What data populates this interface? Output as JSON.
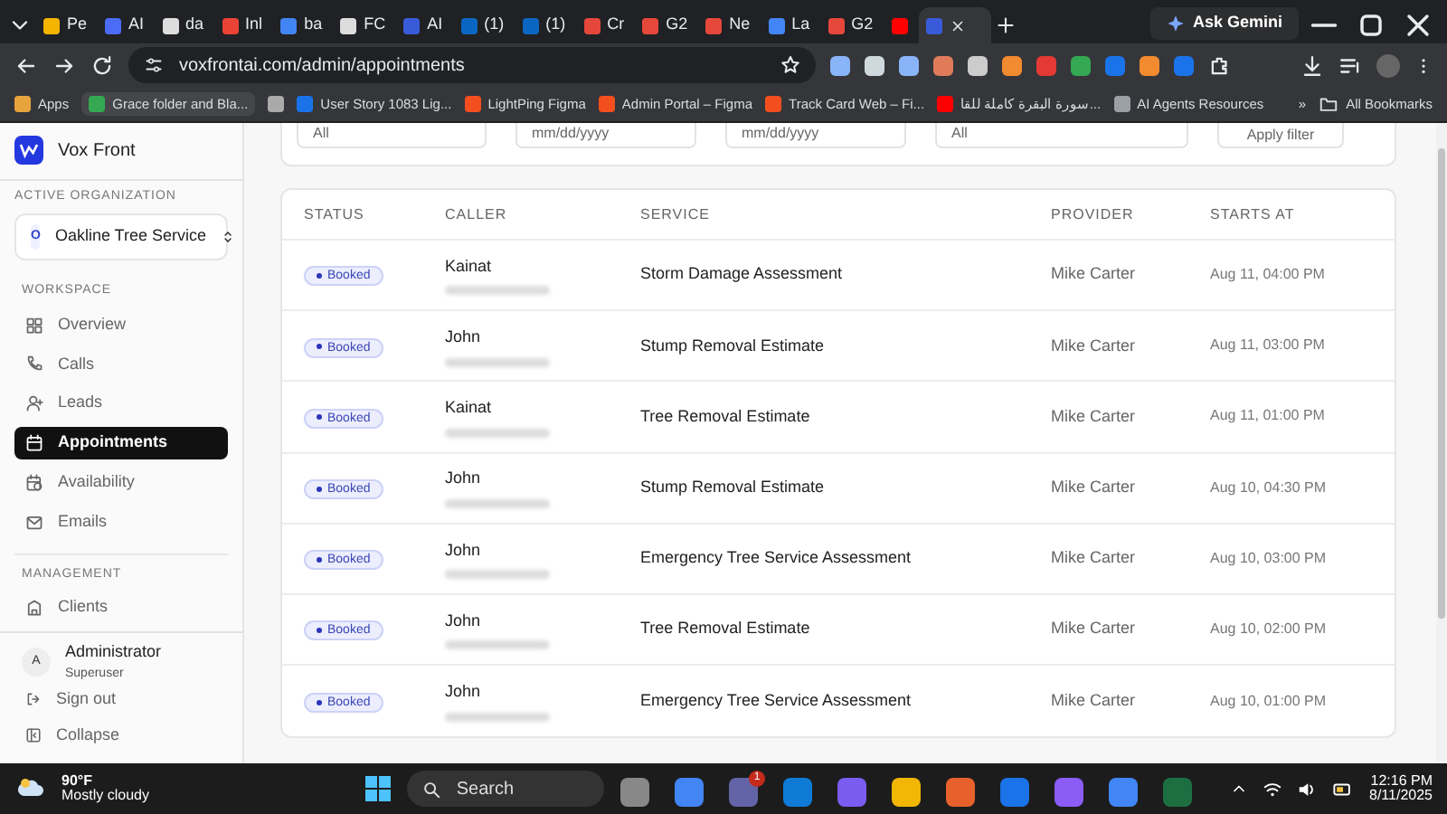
{
  "browser": {
    "tabs": [
      {
        "label": "Pe",
        "color": "#f4b400",
        "selected": false
      },
      {
        "label": "AI",
        "color": "#4a6cf7",
        "selected": false
      },
      {
        "label": "da",
        "color": "#dddddd",
        "selected": false
      },
      {
        "label": "Inl",
        "color": "#ea4335",
        "selected": false
      },
      {
        "label": "ba",
        "color": "#4285f4",
        "selected": false
      },
      {
        "label": "FC",
        "color": "#dddddd",
        "selected": false
      },
      {
        "label": "AI",
        "color": "#3a5bd9",
        "selected": false
      },
      {
        "label": "(1)",
        "color": "#0a66c2",
        "selected": false
      },
      {
        "label": "(1)",
        "color": "#0a66c2",
        "selected": false
      },
      {
        "label": "Cr",
        "color": "#e5483b",
        "selected": false
      },
      {
        "label": "G2",
        "color": "#e5483b",
        "selected": false
      },
      {
        "label": "Ne",
        "color": "#e5483b",
        "selected": false
      },
      {
        "label": "La",
        "color": "#4285f4",
        "selected": false
      },
      {
        "label": "G2",
        "color": "#e5483b",
        "selected": false
      },
      {
        "color": "#ff0000",
        "selected": false
      },
      {
        "color": "#3a5bd9",
        "selected": true
      }
    ],
    "ask_button": "Ask Gemini",
    "url": "voxfrontai.com/admin/appointments",
    "bookmarks": [
      {
        "label": "Apps",
        "color": "#e8a33d"
      },
      {
        "label": "Grace folder and Bla...",
        "color": "#34a853"
      },
      {
        "color": "#aaaaaa"
      },
      {
        "label": "User Story 1083 Lig...",
        "color": "#1a73e8"
      },
      {
        "label": "LightPing Figma",
        "color": "#f24e1e"
      },
      {
        "label": "Admin Portal – Figma",
        "color": "#f24e1e"
      },
      {
        "label": "Track Card Web – Fi...",
        "color": "#f24e1e"
      },
      {
        "label": "سورة البقرة كاملة للقا...",
        "color": "#ff0000"
      },
      {
        "label": "AI Agents Resources",
        "color": "#9aa0a6"
      }
    ],
    "more_bookmarks": "»",
    "all_bookmarks": "All Bookmarks"
  },
  "sidebar": {
    "brand": "Vox Front",
    "org_label": "ACTIVE ORGANIZATION",
    "org_initial": "O",
    "org_name": "Oakline Tree Service",
    "sections": [
      {
        "title": "WORKSPACE",
        "items": [
          {
            "label": "Overview",
            "kind": "grid",
            "selected": false
          },
          {
            "label": "Calls",
            "kind": "phone",
            "selected": false
          },
          {
            "label": "Leads",
            "kind": "user",
            "selected": false
          },
          {
            "label": "Appointments",
            "kind": "calendar",
            "selected": true
          },
          {
            "label": "Availability",
            "kind": "calendar-clock",
            "selected": false
          },
          {
            "label": "Emails",
            "kind": "mail",
            "selected": false
          }
        ]
      },
      {
        "title": "MANAGEMENT",
        "items": [
          {
            "label": "Clients",
            "kind": "building",
            "selected": false
          }
        ]
      }
    ],
    "user": {
      "initial": "A",
      "name": "Administrator",
      "role": "Superuser"
    },
    "footer_links": [
      {
        "label": "Sign out",
        "kind": "signout"
      },
      {
        "label": "Collapse",
        "kind": "collapse"
      }
    ]
  },
  "filters": [
    "All",
    "mm/dd/yyyy",
    "mm/dd/yyyy",
    "All"
  ],
  "filter_button": "Apply filter",
  "table": {
    "columns": [
      "STATUS",
      "CALLER",
      "SERVICE",
      "PROVIDER",
      "STARTS AT"
    ],
    "rows": [
      {
        "status": "Booked",
        "caller": "Kainat",
        "service": "Storm Damage Assessment",
        "provider": "Mike Carter",
        "starts_at": "Aug 11, 04:00 PM"
      },
      {
        "status": "Booked",
        "caller": "John",
        "service": "Stump Removal Estimate",
        "provider": "Mike Carter",
        "starts_at": "Aug 11, 03:00 PM"
      },
      {
        "status": "Booked",
        "caller": "Kainat",
        "service": "Tree Removal Estimate",
        "provider": "Mike Carter",
        "starts_at": "Aug 11, 01:00 PM"
      },
      {
        "status": "Booked",
        "caller": "John",
        "service": "Stump Removal Estimate",
        "provider": "Mike Carter",
        "starts_at": "Aug 10, 04:30 PM"
      },
      {
        "status": "Booked",
        "caller": "John",
        "service": "Emergency Tree Service Assessment",
        "provider": "Mike Carter",
        "starts_at": "Aug 10, 03:00 PM"
      },
      {
        "status": "Booked",
        "caller": "John",
        "service": "Tree Removal Estimate",
        "provider": "Mike Carter",
        "starts_at": "Aug 10, 02:00 PM"
      },
      {
        "status": "Booked",
        "caller": "John",
        "service": "Emergency Tree Service Assessment",
        "provider": "Mike Carter",
        "starts_at": "Aug 10, 01:00 PM"
      }
    ]
  },
  "taskbar": {
    "temperature": "90°F",
    "weather": "Mostly cloudy",
    "search": "Search",
    "badge": "1",
    "time": "12:16 PM",
    "date": "8/11/2025"
  }
}
